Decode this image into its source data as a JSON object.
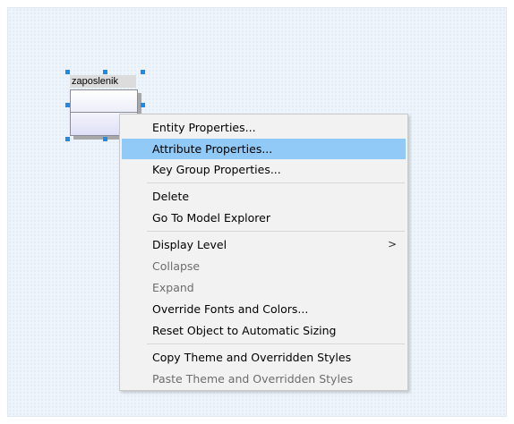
{
  "entity": {
    "name": "zaposlenik"
  },
  "context_menu": {
    "items": [
      {
        "label": "Entity Properties..."
      },
      {
        "label": "Attribute Properties..."
      },
      {
        "label": "Key Group Properties..."
      },
      {
        "label": "Delete"
      },
      {
        "label": "Go To Model Explorer"
      },
      {
        "label": "Display Level",
        "submenu_arrow": ">"
      },
      {
        "label": "Collapse"
      },
      {
        "label": "Expand"
      },
      {
        "label": "Override Fonts and Colors..."
      },
      {
        "label": "Reset Object to Automatic Sizing"
      },
      {
        "label": "Copy Theme and Overridden Styles"
      },
      {
        "label": "Paste Theme and Overridden Styles"
      }
    ],
    "highlight_color": "#91c9f7"
  },
  "colors": {
    "canvas": "#eef4fb",
    "selection_handle": "#1e8be8",
    "menu_background": "#f2f2f2"
  }
}
